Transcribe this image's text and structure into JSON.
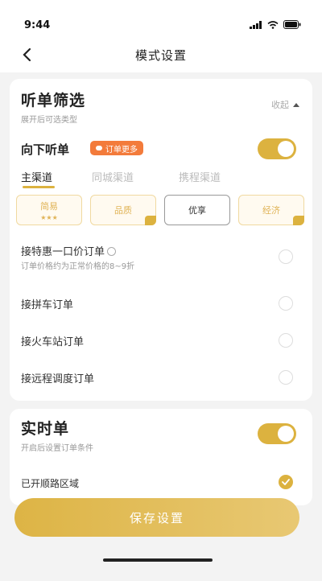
{
  "status": {
    "time": "9:44"
  },
  "nav": {
    "title": "模式设置"
  },
  "filter": {
    "title": "听单筛选",
    "subtitle": "展开后可选类型",
    "collapse_label": "收起",
    "down_label": "向下听单",
    "down_badge": "订单更多",
    "down_enabled": true,
    "tabs": [
      {
        "label": "主渠道",
        "active": true
      },
      {
        "label": "同城渠道",
        "active": false
      },
      {
        "label": "携程渠道",
        "active": false
      }
    ],
    "levels": [
      {
        "name": "简易",
        "sub": "★★★"
      },
      {
        "name": "品质",
        "sub": ""
      },
      {
        "name": "优享",
        "sub": ""
      },
      {
        "name": "经济",
        "sub": ""
      }
    ],
    "options": [
      {
        "label": "接特惠一口价订单",
        "sub": "订单价格约为正常价格的8~9折",
        "checked": false
      },
      {
        "label": "接拼车订单",
        "sub": "",
        "checked": false
      },
      {
        "label": "接火车站订单",
        "sub": "",
        "checked": false
      },
      {
        "label": "接远程调度订单",
        "sub": "",
        "checked": false
      }
    ]
  },
  "realtime": {
    "title": "实时单",
    "subtitle": "开启后设置订单条件",
    "enabled": true,
    "region_label": "已开顺路区域",
    "region_checked": true
  },
  "footer": {
    "save_label": "保存设置"
  },
  "colors": {
    "accent": "#dcb23f",
    "badge": "#f37b3b",
    "background": "#f3f3f3"
  }
}
